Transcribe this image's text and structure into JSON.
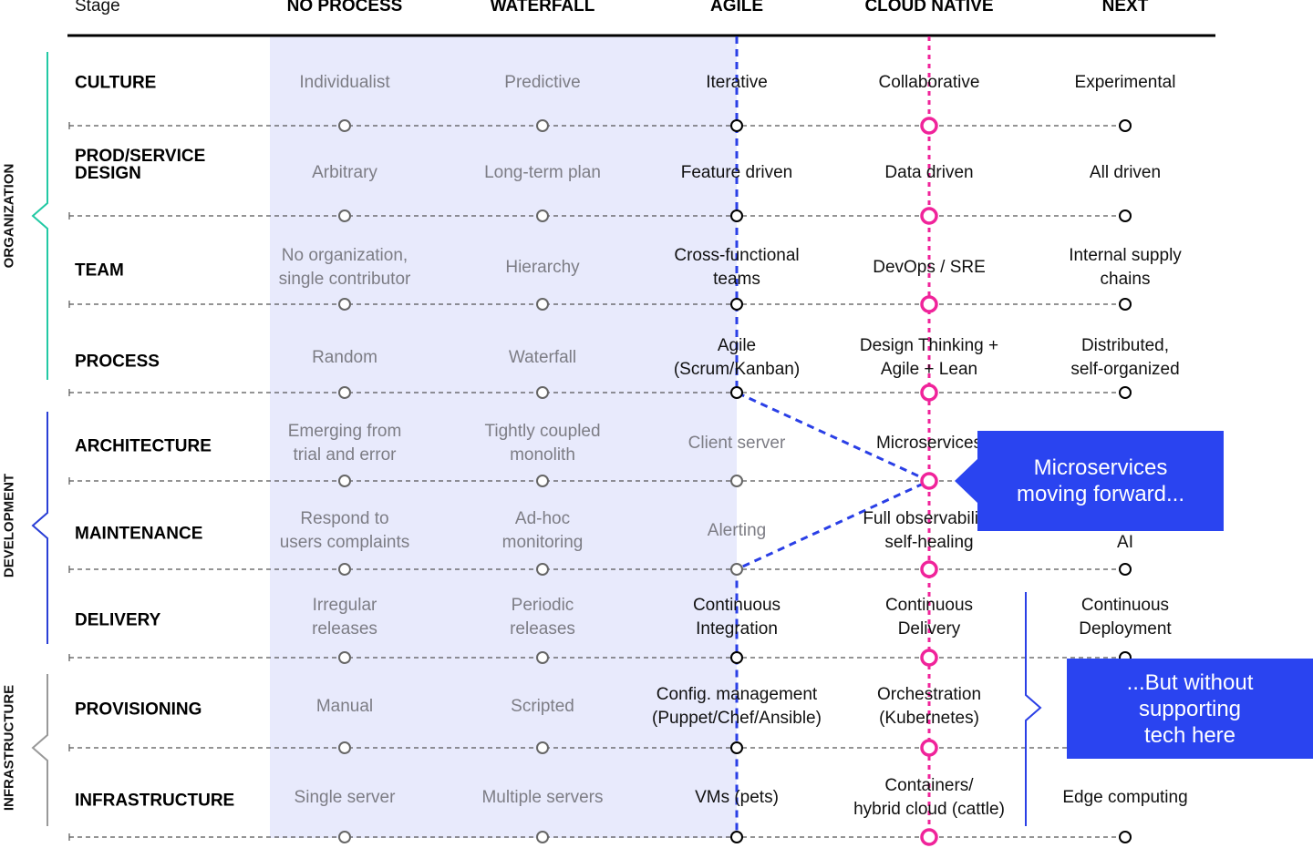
{
  "header": {
    "stage_label": "Stage",
    "columns": [
      "NO PROCESS",
      "WATERFALL",
      "AGILE",
      "CLOUD NATIVE",
      "NEXT"
    ]
  },
  "groups": [
    {
      "label": "ORGANIZATION",
      "color": "#22c9a4"
    },
    {
      "label": "DEVELOPMENT",
      "color": "#2a3fd6"
    },
    {
      "label": "INFRASTRUCTURE",
      "color": "#999999"
    }
  ],
  "rows": [
    {
      "label": [
        "CULTURE"
      ],
      "cells": [
        {
          "text": [
            "Individualist"
          ],
          "muted": true
        },
        {
          "text": [
            "Predictive"
          ],
          "muted": true
        },
        {
          "text": [
            "Iterative"
          ],
          "muted": false
        },
        {
          "text": [
            "Collaborative"
          ],
          "muted": false
        },
        {
          "text": [
            "Experimental"
          ],
          "muted": false
        }
      ]
    },
    {
      "label": [
        "PROD/SERVICE",
        "DESIGN"
      ],
      "cells": [
        {
          "text": [
            "Arbitrary"
          ],
          "muted": true
        },
        {
          "text": [
            "Long-term plan"
          ],
          "muted": true
        },
        {
          "text": [
            "Feature driven"
          ],
          "muted": false
        },
        {
          "text": [
            "Data driven"
          ],
          "muted": false
        },
        {
          "text": [
            "All driven"
          ],
          "muted": false
        }
      ]
    },
    {
      "label": [
        "TEAM"
      ],
      "cells": [
        {
          "text": [
            "No organization,",
            "single contributor"
          ],
          "muted": true
        },
        {
          "text": [
            "Hierarchy"
          ],
          "muted": true
        },
        {
          "text": [
            "Cross-functional",
            "teams"
          ],
          "muted": false
        },
        {
          "text": [
            "DevOps / SRE"
          ],
          "muted": false
        },
        {
          "text": [
            "Internal supply",
            "chains"
          ],
          "muted": false
        }
      ]
    },
    {
      "label": [
        "PROCESS"
      ],
      "cells": [
        {
          "text": [
            "Random"
          ],
          "muted": true
        },
        {
          "text": [
            "Waterfall"
          ],
          "muted": true
        },
        {
          "text": [
            "Agile",
            "(Scrum/Kanban)"
          ],
          "muted": false
        },
        {
          "text": [
            "Design Thinking +",
            "Agile + Lean"
          ],
          "muted": false
        },
        {
          "text": [
            "Distributed,",
            "self-organized"
          ],
          "muted": false
        }
      ]
    },
    {
      "label": [
        "ARCHITECTURE"
      ],
      "cells": [
        {
          "text": [
            "Emerging from",
            "trial and error"
          ],
          "muted": true
        },
        {
          "text": [
            "Tightly coupled",
            "monolith"
          ],
          "muted": true
        },
        {
          "text": [
            "Client server"
          ],
          "muted": true
        },
        {
          "text": [
            "Microservices"
          ],
          "muted": false
        },
        {
          "text": [],
          "muted": false
        }
      ]
    },
    {
      "label": [
        "MAINTENANCE"
      ],
      "cells": [
        {
          "text": [
            "Respond to",
            "users complaints"
          ],
          "muted": true
        },
        {
          "text": [
            "Ad-hoc",
            "monitoring"
          ],
          "muted": true
        },
        {
          "text": [
            "Alerting"
          ],
          "muted": true
        },
        {
          "text": [
            "Full observability,",
            "self-healing"
          ],
          "muted": false
        },
        {
          "text": [
            "",
            "AI"
          ],
          "muted": false
        }
      ]
    },
    {
      "label": [
        "DELIVERY"
      ],
      "cells": [
        {
          "text": [
            "Irregular",
            "releases"
          ],
          "muted": true
        },
        {
          "text": [
            "Periodic",
            "releases"
          ],
          "muted": true
        },
        {
          "text": [
            "Continuous",
            "Integration"
          ],
          "muted": false
        },
        {
          "text": [
            "Continuous",
            "Delivery"
          ],
          "muted": false
        },
        {
          "text": [
            "Continuous",
            "Deployment"
          ],
          "muted": false
        }
      ]
    },
    {
      "label": [
        "PROVISIONING"
      ],
      "cells": [
        {
          "text": [
            "Manual"
          ],
          "muted": true
        },
        {
          "text": [
            "Scripted"
          ],
          "muted": true
        },
        {
          "text": [
            "Config. management",
            "(Puppet/Chef/Ansible)"
          ],
          "muted": false
        },
        {
          "text": [
            "Orchestration",
            "(Kubernetes)"
          ],
          "muted": false
        },
        {
          "text": [],
          "muted": false
        }
      ]
    },
    {
      "label": [
        "INFRASTRUCTURE"
      ],
      "cells": [
        {
          "text": [
            "Single server"
          ],
          "muted": true
        },
        {
          "text": [
            "Multiple servers"
          ],
          "muted": true
        },
        {
          "text": [
            "VMs (pets)"
          ],
          "muted": false
        },
        {
          "text": [
            "Containers/",
            "hybrid cloud (cattle)"
          ],
          "muted": false
        },
        {
          "text": [
            "Edge computing"
          ],
          "muted": false
        }
      ]
    }
  ],
  "callouts": [
    {
      "lines": [
        "Microservices",
        "moving forward..."
      ]
    },
    {
      "lines": [
        "...But without",
        "supporting",
        "tech here"
      ]
    }
  ],
  "colors": {
    "shade": "#e8eafc",
    "agile_path": "#2a3fe6",
    "cloud_native_line": "#f0239a",
    "callout": "#2a44f0"
  }
}
